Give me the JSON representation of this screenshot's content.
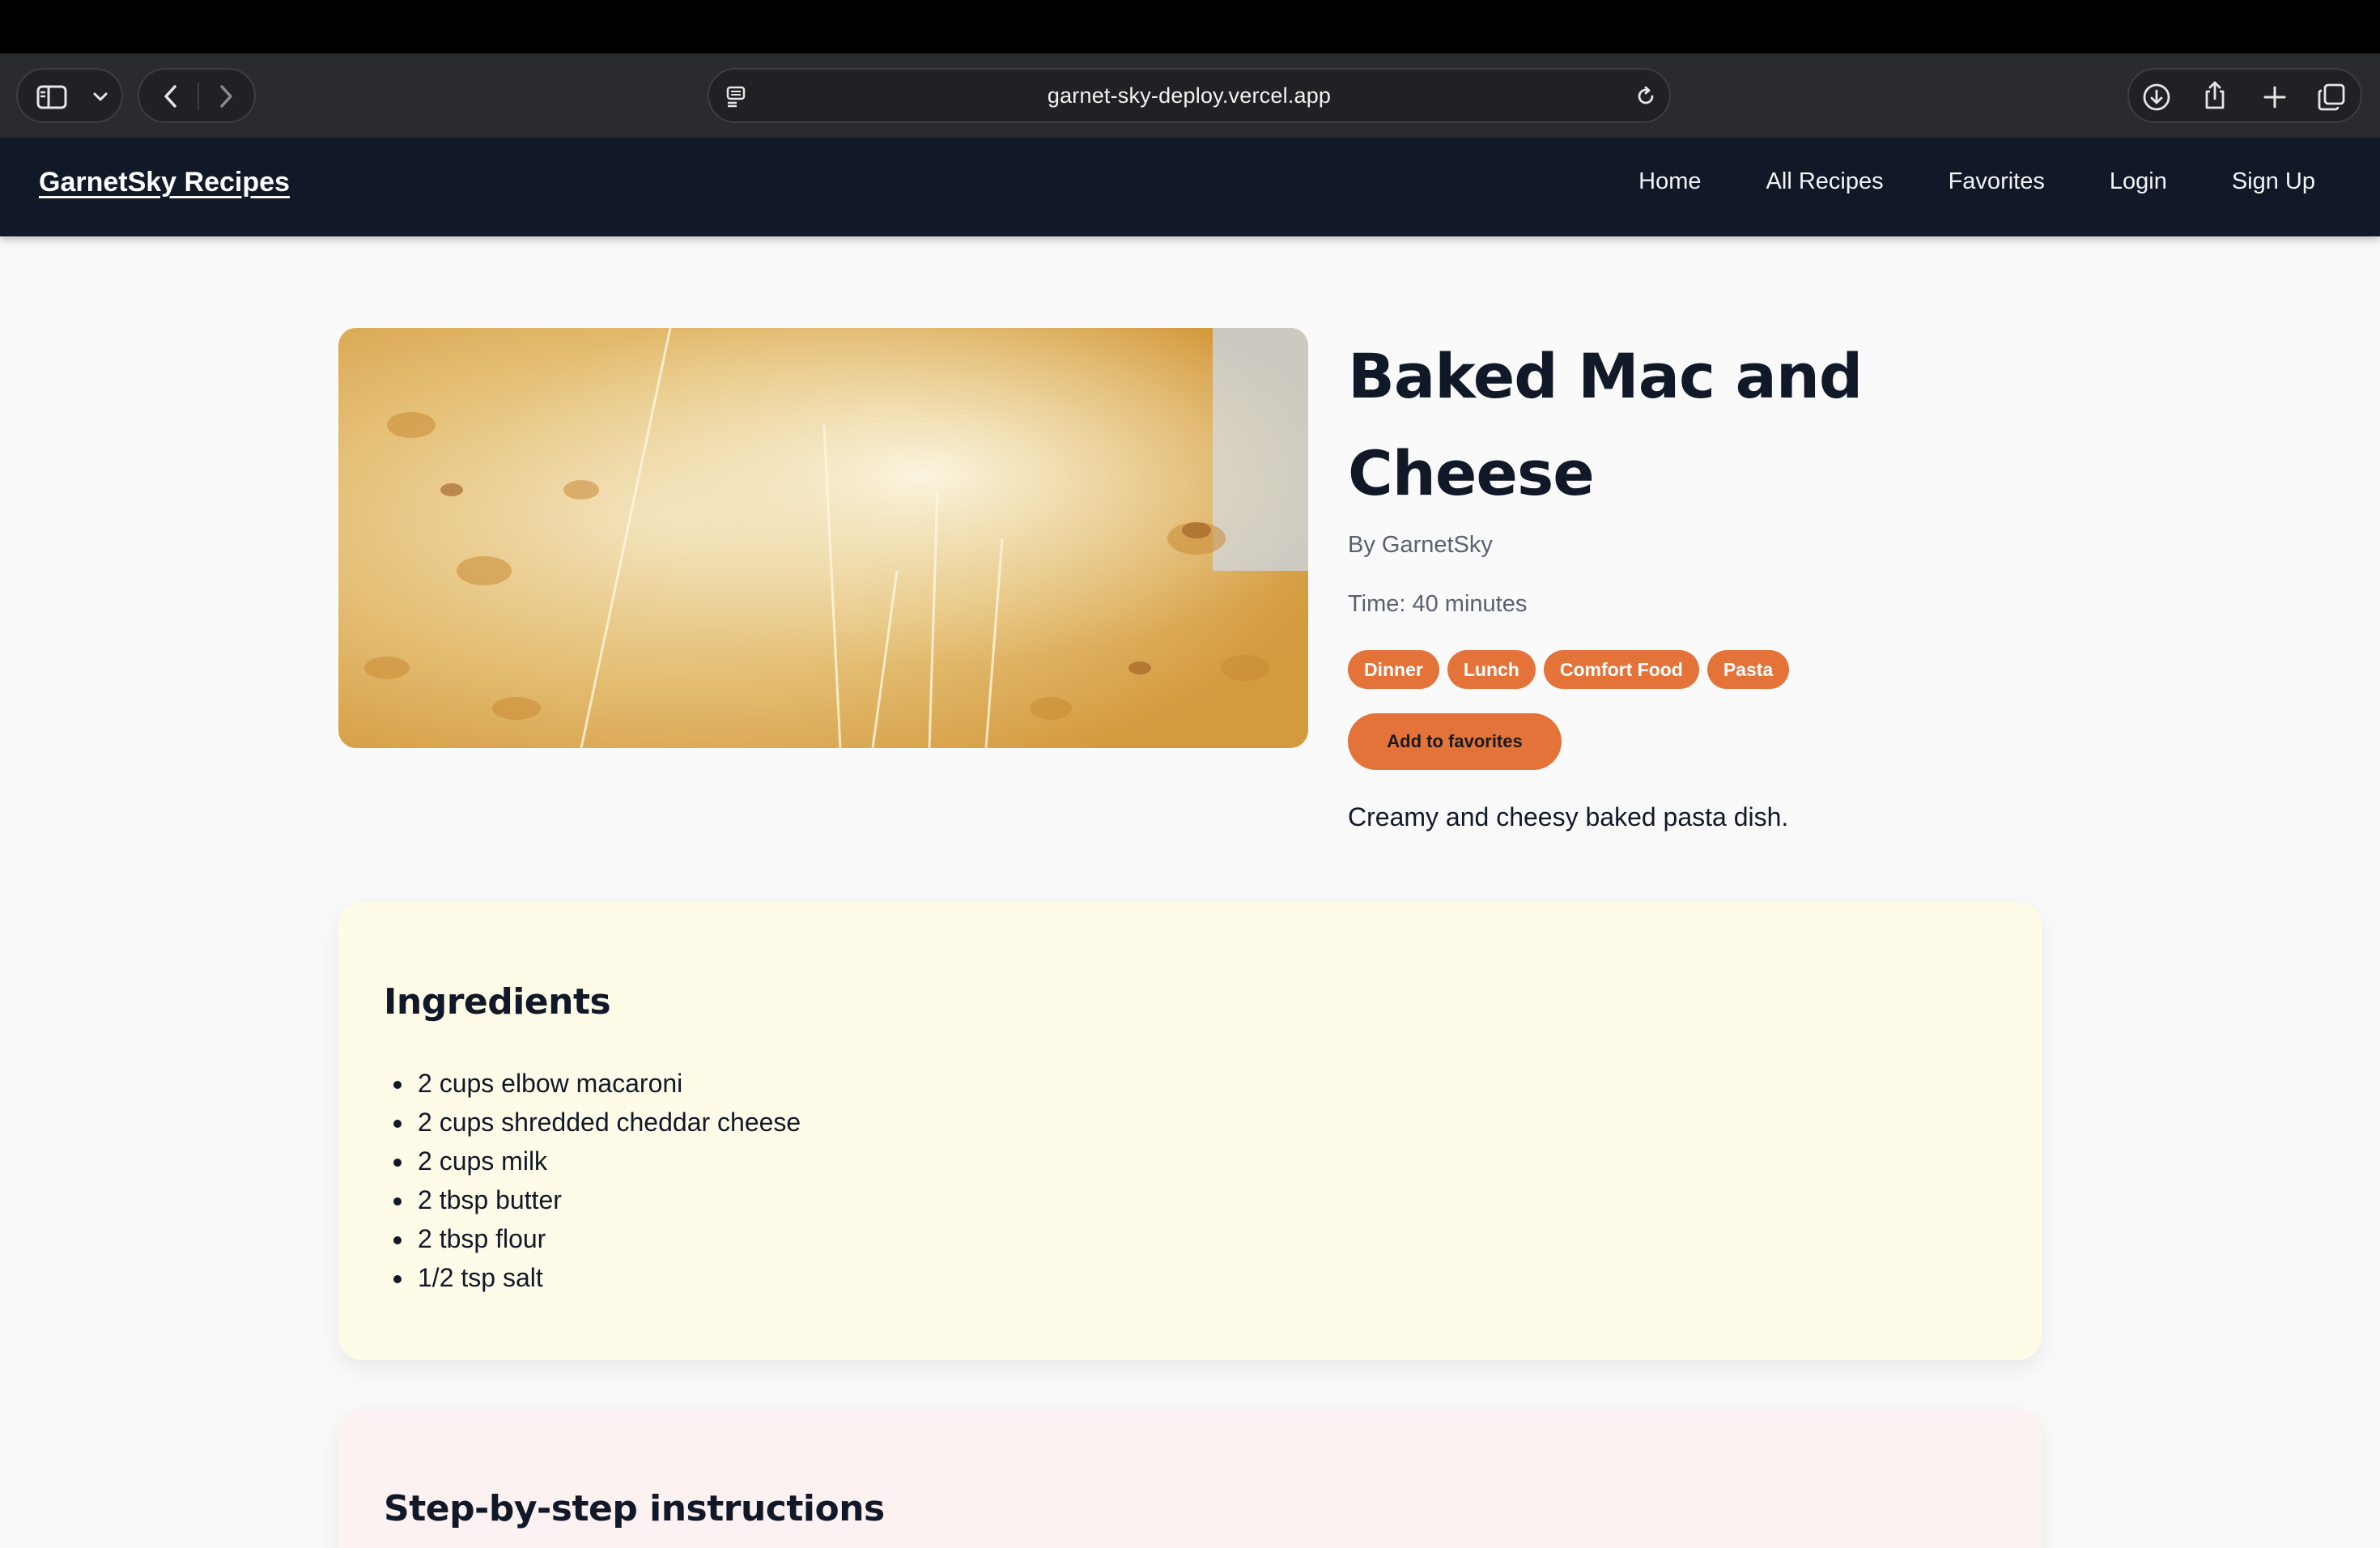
{
  "browser": {
    "url": "garnet-sky-deploy.vercel.app",
    "icons": [
      "sidebar-icon",
      "chevron-down-icon",
      "back-icon",
      "forward-icon",
      "reader-icon",
      "reload-icon",
      "download-icon",
      "share-icon",
      "new-tab-icon",
      "tabs-overview-icon"
    ]
  },
  "site": {
    "brand": "GarnetSky Recipes",
    "nav": {
      "home": "Home",
      "all_recipes": "All Recipes",
      "favorites": "Favorites",
      "login": "Login",
      "signup": "Sign Up"
    }
  },
  "recipe": {
    "title": "Baked Mac and Cheese",
    "byline": "By GarnetSky",
    "time": "Time: 40 minutes",
    "tags": [
      "Dinner",
      "Lunch",
      "Comfort Food",
      "Pasta"
    ],
    "favorite_button": "Add to favorites",
    "description": "Creamy and cheesy baked pasta dish.",
    "ingredients_heading": "Ingredients",
    "ingredients": [
      "2 cups elbow macaroni",
      "2 cups shredded cheddar cheese",
      "2 cups milk",
      "2 tbsp butter",
      "2 tbsp flour",
      "1/2 tsp salt"
    ],
    "instructions_heading": "Step-by-step instructions"
  },
  "colors": {
    "header_bg": "#111827",
    "accent": "#e4733a",
    "ingredients_card_bg": "#fefce8",
    "instructions_card_bg": "#fdf2f2"
  }
}
